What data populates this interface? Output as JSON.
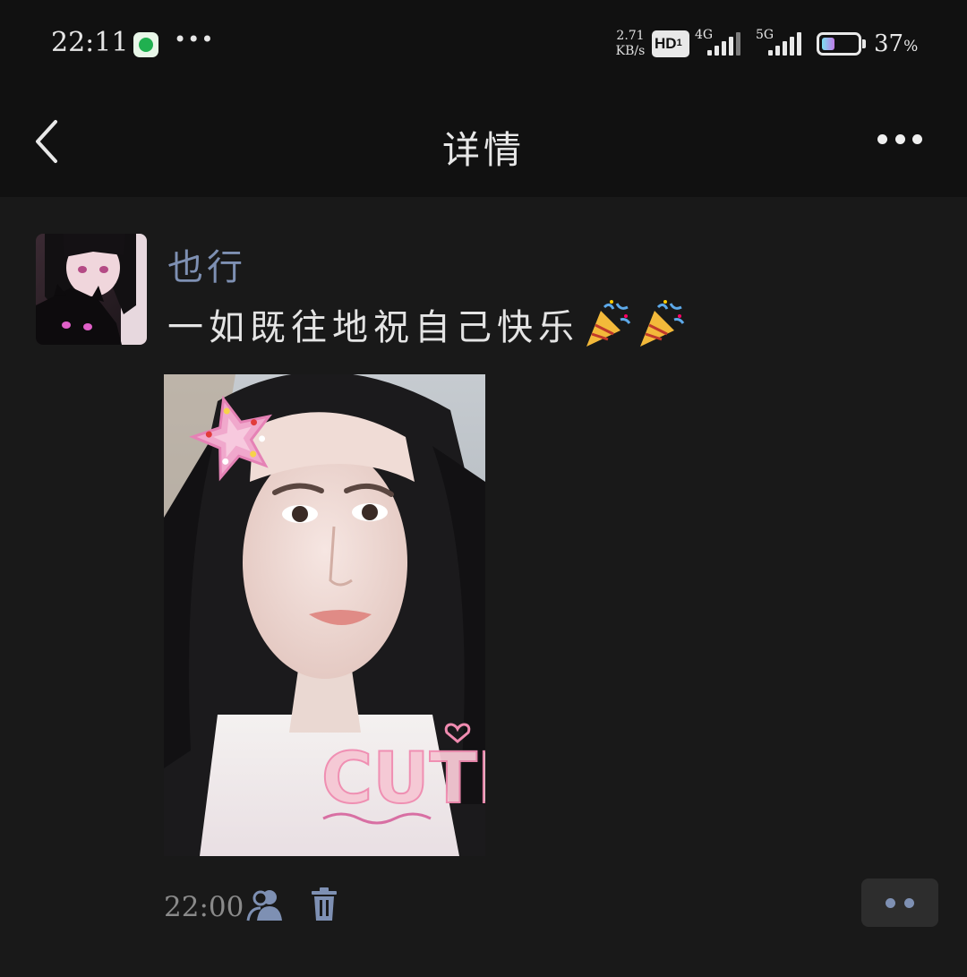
{
  "status_bar": {
    "time": "22:11",
    "notification_icon": "wechat-green-icon",
    "dots": "•••",
    "net_speed_value": "2.71",
    "net_speed_unit": "KB/s",
    "hd_badge": "HD",
    "sim1_gen": "4G",
    "sim2_gen": "5G",
    "battery_percent": "37",
    "battery_unit": "%",
    "battery_level": 0.37
  },
  "nav": {
    "back_icon": "chevron-left-icon",
    "title": "详情",
    "more_icon": "more-dots-icon"
  },
  "post": {
    "username": "也行",
    "text": "一如既往地祝自己快乐",
    "emoji": [
      "party-popper-icon",
      "party-popper-icon"
    ],
    "photo_sticker_text": "CUTE",
    "time": "22:00",
    "visibility_icon": "friends-icon",
    "delete_icon": "trash-icon",
    "action_icon": "comment-dots-icon"
  },
  "colors": {
    "background": "#191919",
    "header": "#111111",
    "username": "#7e90b3",
    "text": "#e4e4e4",
    "meta": "#8a8a8a"
  }
}
